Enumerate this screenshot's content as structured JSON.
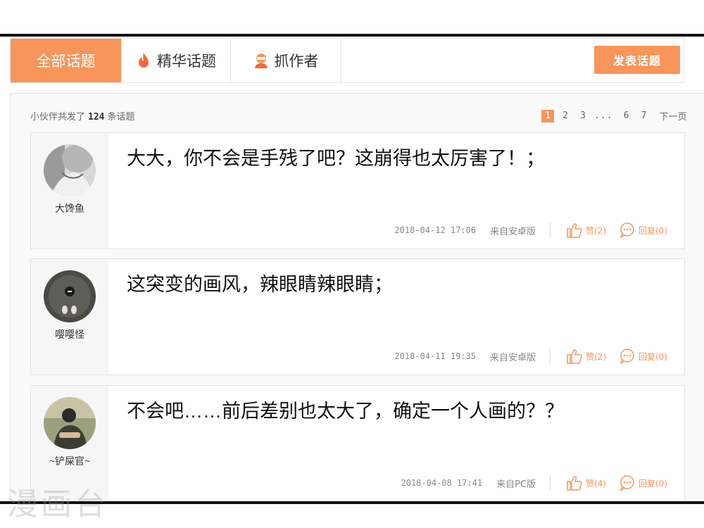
{
  "tabs": {
    "all": "全部话题",
    "hot": "精华话题",
    "author": "抓作者",
    "post_button": "发表话题"
  },
  "summary": {
    "prefix": "小伙伴共发了",
    "count": "124",
    "suffix": "条话题"
  },
  "pagination": {
    "pages": [
      "1",
      "2",
      "3",
      "...",
      "6",
      "7"
    ],
    "current": "1",
    "next": "下一页"
  },
  "comments": [
    {
      "user": "大馋鱼",
      "text": "大大，你不会是手残了吧？这崩得也太厉害了！；",
      "date": "2018-04-12 17:06",
      "source": "来自安卓版",
      "likes": "赞(2)",
      "replies": "回复(0)"
    },
    {
      "user": "嘤嘤怪",
      "text": "这突变的画风，辣眼睛辣眼睛；",
      "date": "2018-04-11 19:35",
      "source": "来自安卓版",
      "likes": "赞(2)",
      "replies": "回复(0)"
    },
    {
      "user": "~铲屎官~",
      "text": "不会吧……前后差别也太大了，确定一个人画的？？",
      "date": "2018-04-08 17:41",
      "source": "来自PC版",
      "likes": "赞(4)",
      "replies": "回复(0)"
    }
  ],
  "watermark": "漫画台",
  "colors": {
    "accent": "#f7955a",
    "border": "#e6e6e6",
    "frame": "#111111"
  },
  "icons": [
    "flame-icon",
    "author-avatar-icon",
    "thumbs-up-icon",
    "reply-bubble-icon"
  ]
}
